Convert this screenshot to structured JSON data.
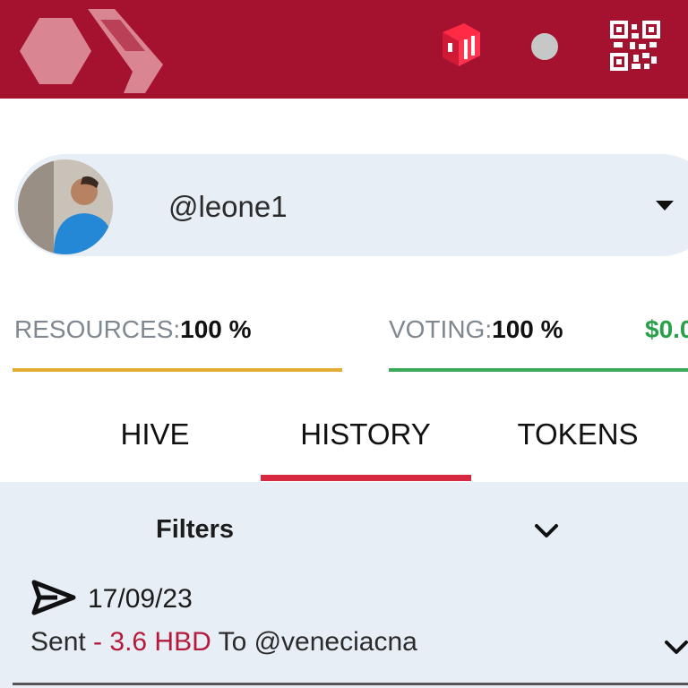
{
  "header": {
    "logo_icon": "hive-logo-icon",
    "keychain_icon": "keychain-box-icon",
    "status_icon": "status-dot-icon",
    "qr_icon": "qr-code-icon",
    "colors": {
      "background": "#a51230",
      "status_dot": "#c7c7c7"
    }
  },
  "account": {
    "username": "@leone1",
    "avatar_icon": "user-avatar",
    "dropdown_icon": "caret-down-icon"
  },
  "resources": {
    "resources_label": "RESOURCES:",
    "resources_value": "100 %",
    "voting_label": "VOTING:",
    "voting_value": "100 %",
    "value_text": "$0.0",
    "resources_fill": 1.0,
    "voting_fill": 1.0,
    "colors": {
      "resources_bar": "#e2ad33",
      "voting_bar": "#3aa95a",
      "value": "#27a048"
    }
  },
  "tabs": [
    {
      "label": "HIVE",
      "active": false
    },
    {
      "label": "HISTORY",
      "active": true
    },
    {
      "label": "TOKENS",
      "active": false
    }
  ],
  "history": {
    "filters_label": "Filters",
    "filters_icon": "chevron-down-icon",
    "transactions": [
      {
        "icon": "send-icon",
        "date": "17/09/23",
        "type": "Sent",
        "separator": " - ",
        "amount": "3.6 HBD",
        "to_label": " To ",
        "recipient": "@veneciacna",
        "expand_icon": "chevron-down-icon"
      }
    ],
    "colors": {
      "amount": "#b51a3a",
      "panel": "#e8eef6",
      "active_tab": "#d8283f"
    }
  }
}
